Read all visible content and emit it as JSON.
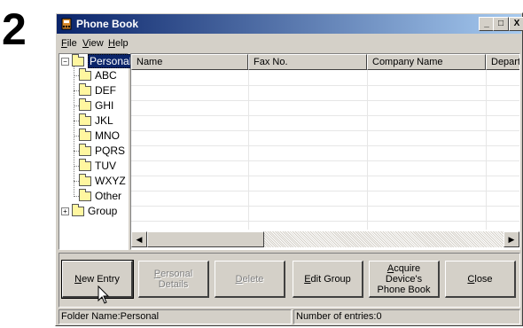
{
  "step_number": "2",
  "window": {
    "title": "Phone Book",
    "minimize": "_",
    "maximize": "□",
    "close": "X"
  },
  "menu": [
    {
      "label": "File",
      "mnemonic": "F",
      "rest": "ile"
    },
    {
      "label": "View",
      "mnemonic": "V",
      "rest": "iew"
    },
    {
      "label": "Help",
      "mnemonic": "H",
      "rest": "elp"
    }
  ],
  "tree": {
    "root": "Personal",
    "children": [
      "ABC",
      "DEF",
      "GHI",
      "JKL",
      "MNO",
      "PQRS",
      "TUV",
      "WXYZ",
      "Other"
    ],
    "group": "Group"
  },
  "list": {
    "columns": [
      "Name",
      "Fax No.",
      "Company Name",
      "Departme"
    ],
    "rows": []
  },
  "buttons": {
    "new_entry": {
      "mnemonic": "N",
      "rest": "ew Entry",
      "enabled": true
    },
    "personal_details": {
      "mnemonic": "P",
      "rest": "ersonal Details",
      "enabled": false
    },
    "delete": {
      "mnemonic": "D",
      "rest": "elete",
      "enabled": false
    },
    "edit_group": {
      "mnemonic": "E",
      "rest": "dit Group",
      "enabled": true
    },
    "acquire": {
      "mnemonic": "A",
      "line1_rest": "cquire Device's",
      "line2": "Phone Book",
      "enabled": true
    },
    "close": {
      "mnemonic": "C",
      "rest": "lose",
      "enabled": true
    }
  },
  "status": {
    "folder": "Folder Name:Personal",
    "entries": "Number of entries:0"
  },
  "colors": {
    "title_start": "#0a246a",
    "title_end": "#a6caf0",
    "face": "#d4d0c8",
    "selection": "#0a246a"
  }
}
